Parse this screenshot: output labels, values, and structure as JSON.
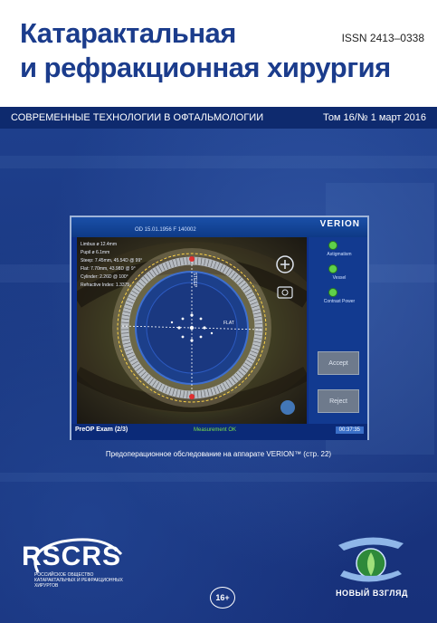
{
  "header": {
    "title_line1": "Катарактальная",
    "title_line2": "и рефракционная хирургия",
    "issn": "ISSN 2413–0338"
  },
  "subbar": {
    "left": "СОВРЕМЕННЫЕ ТЕХНОЛОГИИ В ОФТАЛЬМОЛОГИИ",
    "right": "Том 16/№ 1  март 2016"
  },
  "device": {
    "brand": "VERION",
    "patient_info": "OD 15.01.1956  F 140002",
    "readouts": [
      "Limbus  ø 12.4mm",
      "Pupil  ø 6.1mm",
      "Steep: 7.45mm, 45.54D @ 99°",
      "Flat: 7.70mm, 43.98D @ 9°",
      "Cylinder: 2.26D @ 100°",
      "Refractive Index: 1.3375"
    ],
    "steep_label": "STEEP",
    "flat_label": "FLAT",
    "indicators": [
      "Astigmatism",
      "Vessel",
      "Contrast Power"
    ],
    "accept_label": "Accept",
    "reject_label": "Reject",
    "exam_label": "PreOP Exam (2/3)",
    "measurement_label": "Measurement OK",
    "time_label": "00:37:35"
  },
  "caption": "Предоперационное обследование на аппарате VERION™ (стр. 22)",
  "footer": {
    "rscrs_word": "RSCRS",
    "rscrs_sub": "РОССИЙСКОЕ ОБЩЕСТВО КАТАРАКТАЛЬНЫХ И РЕФРАКЦИОННЫХ ХИРУРГОВ",
    "age_rating": "16+",
    "publisher": "НОВЫЙ ВЗГЛЯД"
  }
}
